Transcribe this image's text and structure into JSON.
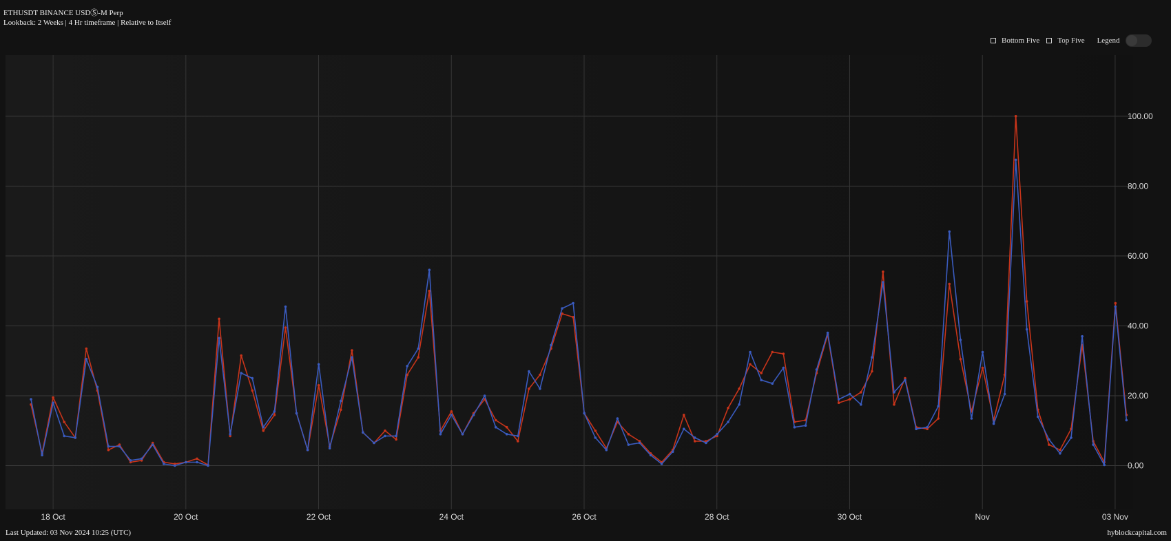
{
  "header": {
    "title": "ETHUSDT BINANCE USDⓈ-M Perp",
    "subtitle": "Lookback: 2 Weeks | 4 Hr timeframe | Relative to Itself"
  },
  "controls": {
    "bottom_five": "Bottom Five",
    "top_five": "Top Five",
    "legend": "Legend",
    "legend_toggle_on": false
  },
  "footer": {
    "last_updated": "Last Updated: 03 Nov 2024 10:25 (UTC)",
    "site": "hyblockcapital.com"
  },
  "chart_data": {
    "type": "line",
    "x_unit": "days since 17 Oct 2024 00:00 UTC",
    "x_start": 0.667,
    "x_step": 0.1667,
    "xlim": [
      0.2,
      17.25
    ],
    "ylim": [
      -12.5,
      117.5
    ],
    "y_ticks": [
      0,
      20,
      40,
      60,
      80,
      100
    ],
    "y_tick_labels": [
      "0.00",
      "20.00",
      "40.00",
      "60.00",
      "80.00",
      "100.00"
    ],
    "x_ticks": [
      1,
      3,
      5,
      7,
      9,
      11,
      13,
      15,
      17
    ],
    "x_tick_labels": [
      "18 Oct",
      "20 Oct",
      "22 Oct",
      "24 Oct",
      "26 Oct",
      "28 Oct",
      "30 Oct",
      "Nov",
      "03 Nov"
    ],
    "grid": true,
    "series": [
      {
        "color": "#c8341a",
        "values": [
          17.5,
          3.5,
          19.5,
          12.5,
          8,
          33.5,
          21.5,
          4.5,
          6,
          1,
          1.5,
          6.5,
          1,
          0.5,
          1,
          2,
          0.2,
          42,
          8.5,
          31.5,
          21.5,
          10,
          14.5,
          39.5,
          15,
          4.5,
          23,
          5.5,
          16,
          33,
          9.5,
          6.5,
          10,
          7.5,
          26,
          31,
          50,
          10,
          15.5,
          9,
          15,
          19,
          13,
          11,
          7,
          22,
          26,
          33.5,
          43.5,
          42.5,
          15,
          10,
          5,
          12.5,
          9,
          7,
          3.5,
          1,
          4.5,
          14.5,
          7,
          7,
          8.5,
          16.5,
          22,
          29,
          26.5,
          32.5,
          32,
          12.5,
          13,
          26.5,
          37.5,
          18,
          19,
          21,
          27,
          55.5,
          17.5,
          25,
          11,
          10.5,
          13.5,
          52,
          30.5,
          15.5,
          28,
          13,
          26,
          100,
          47,
          16,
          6,
          4.5,
          10.5,
          34.5,
          7,
          1,
          46.5,
          14.5
        ]
      },
      {
        "color": "#3a5bbf",
        "values": [
          19,
          3,
          18,
          8.5,
          8,
          30.5,
          22.5,
          5.5,
          5.5,
          1.5,
          2,
          6,
          0.5,
          0,
          1,
          1,
          0,
          36.5,
          9,
          26.5,
          25,
          11,
          15.5,
          45.5,
          15,
          4.5,
          29,
          5,
          18.5,
          31,
          9.5,
          6.5,
          8.5,
          8.5,
          28.5,
          33.5,
          56,
          9,
          14.5,
          9,
          14.5,
          20,
          11,
          9,
          8.5,
          27,
          22,
          34.5,
          45,
          46.5,
          15,
          8,
          4.5,
          13.5,
          6,
          6.5,
          3,
          0.5,
          4,
          10.5,
          8,
          6.5,
          9,
          12.5,
          17.5,
          32.5,
          24.5,
          23.5,
          28,
          11,
          11.5,
          27.5,
          38,
          19,
          20.5,
          17.5,
          31,
          52.5,
          21,
          24.5,
          10.5,
          11,
          17,
          67,
          36,
          13.5,
          32.5,
          12,
          20.5,
          87.5,
          39,
          14,
          7.5,
          3.5,
          8,
          37,
          6,
          0.2,
          45.5,
          13
        ]
      }
    ]
  }
}
